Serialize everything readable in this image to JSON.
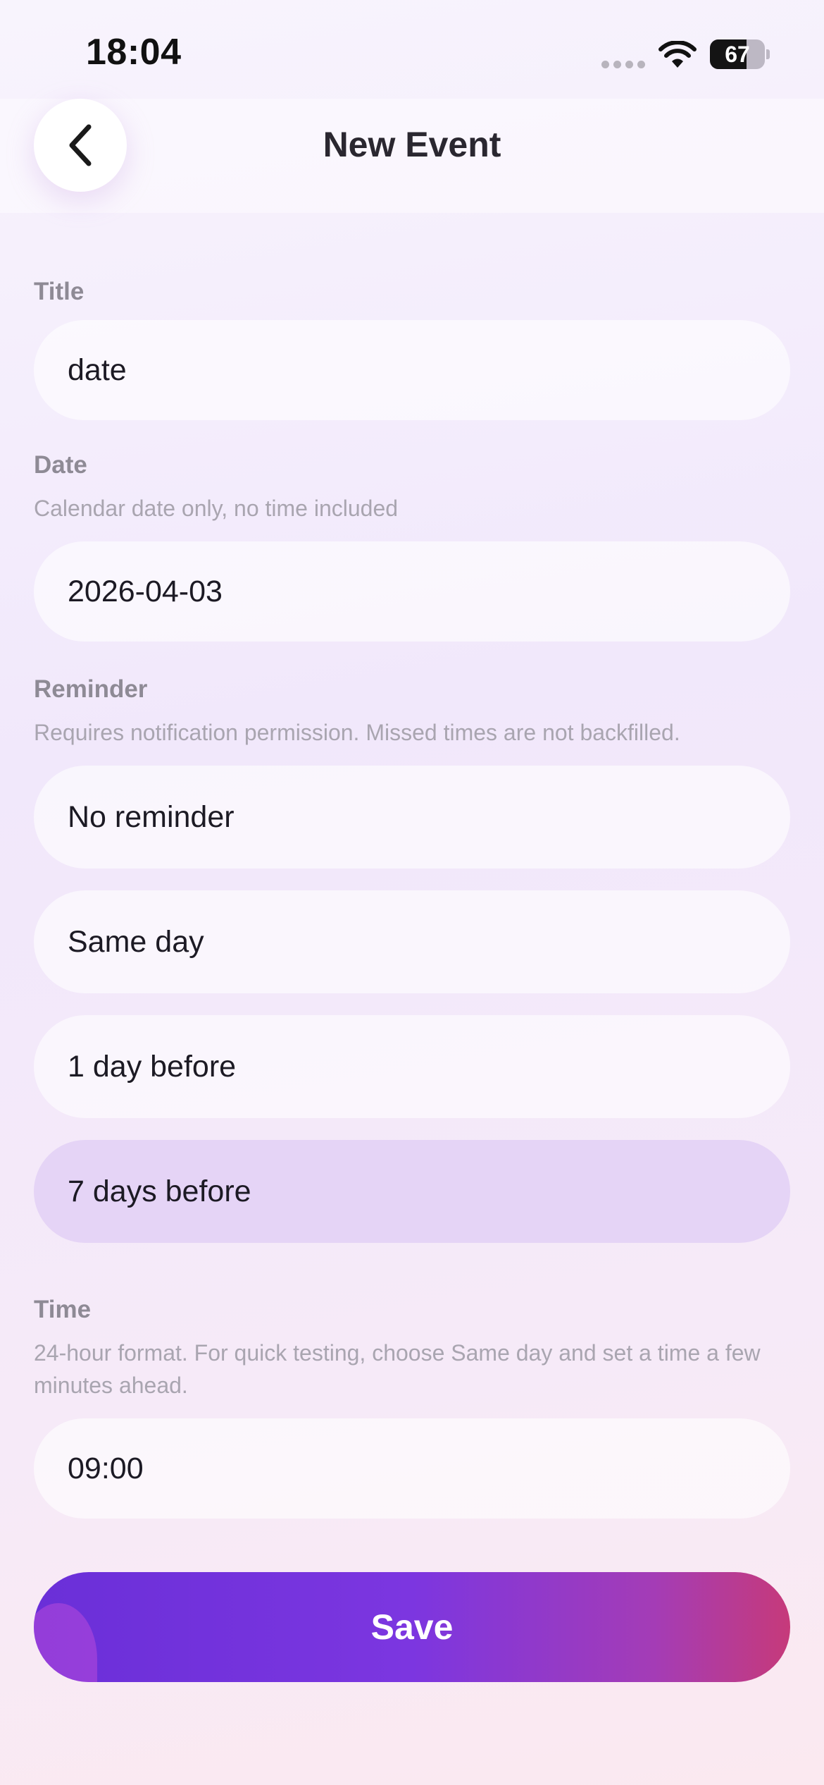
{
  "status_bar": {
    "time": "18:04",
    "battery_level": 67,
    "battery_text": "67",
    "icons": [
      "signal-dots-icon",
      "wifi-icon",
      "battery-icon"
    ]
  },
  "header": {
    "back_icon": "chevron-left-icon",
    "title": "New Event"
  },
  "form": {
    "title": {
      "label": "Title",
      "value": "date"
    },
    "date": {
      "label": "Date",
      "hint": "Calendar date only, no time included",
      "value": "2026-04-03"
    },
    "reminder": {
      "label": "Reminder",
      "hint": "Requires notification permission. Missed times are not backfilled.",
      "options": [
        {
          "label": "No reminder",
          "selected": false
        },
        {
          "label": "Same day",
          "selected": false
        },
        {
          "label": "1 day before",
          "selected": false
        },
        {
          "label": "7 days before",
          "selected": true
        }
      ]
    },
    "time": {
      "label": "Time",
      "hint": "24-hour format. For quick testing, choose Same day and set a time a few minutes ahead.",
      "value": "09:00"
    }
  },
  "actions": {
    "save_label": "Save"
  },
  "colors": {
    "selected_option": "#e5d4f6",
    "save_gradient_start": "#6a2fd8",
    "save_gradient_end": "#c63a7a"
  }
}
